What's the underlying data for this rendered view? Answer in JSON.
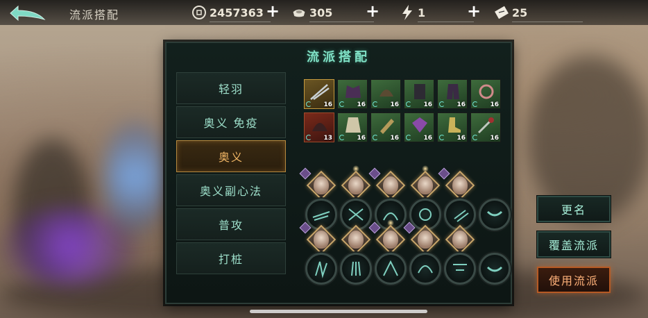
{
  "header": {
    "title": "流派搭配",
    "back_icon": "back-arrow-icon"
  },
  "resources": [
    {
      "name": "coin",
      "icon": "coin-icon",
      "value": "2457363"
    },
    {
      "name": "silver",
      "icon": "silver-ingot-icon",
      "value": "305"
    },
    {
      "name": "stamina",
      "icon": "lightning-icon",
      "value": "1"
    },
    {
      "name": "ticket",
      "icon": "ticket-icon",
      "value": "25"
    }
  ],
  "panel": {
    "title": "流派搭配",
    "categories": [
      {
        "label": "轻羽",
        "active": false
      },
      {
        "label": "奥义 免疫",
        "active": false
      },
      {
        "label": "奥义",
        "active": true
      },
      {
        "label": "奥义副心法",
        "active": false
      },
      {
        "label": "普攻",
        "active": false
      },
      {
        "label": "打桩",
        "active": false
      }
    ],
    "equipment": [
      {
        "level": "16",
        "quality": "gold"
      },
      {
        "level": "16",
        "quality": "green"
      },
      {
        "level": "16",
        "quality": "green"
      },
      {
        "level": "16",
        "quality": "green"
      },
      {
        "level": "16",
        "quality": "green"
      },
      {
        "level": "16",
        "quality": "green"
      },
      {
        "level": "13",
        "quality": "red"
      },
      {
        "level": "16",
        "quality": "green"
      },
      {
        "level": "16",
        "quality": "green"
      },
      {
        "level": "16",
        "quality": "green"
      },
      {
        "level": "16",
        "quality": "green"
      },
      {
        "level": "16",
        "quality": "green"
      }
    ]
  },
  "actions": {
    "rename": "更名",
    "overwrite": "覆盖流派",
    "use": "使用流派"
  },
  "colors": {
    "accent_teal": "#7fe0c5",
    "active_orange": "#f2b766",
    "panel_bg": "#12201d"
  }
}
